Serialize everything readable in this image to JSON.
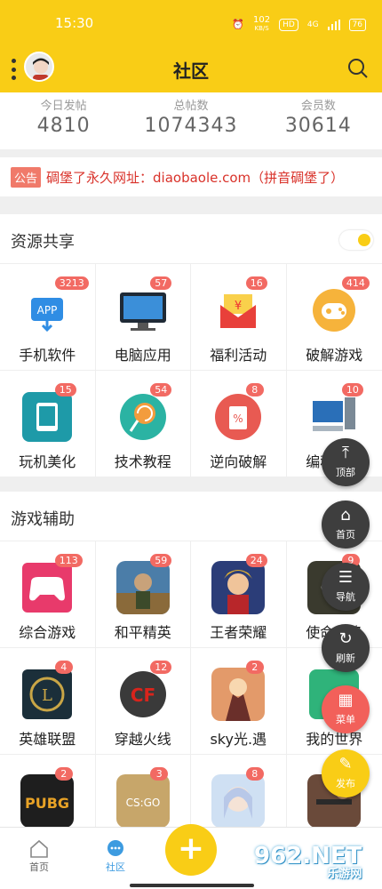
{
  "status": {
    "time": "15:30",
    "speed": "102",
    "speed_unit": "KB/S",
    "hd": "HD",
    "net": "4G",
    "battery": "76"
  },
  "header": {
    "title": "社区"
  },
  "stats": [
    {
      "label": "今日发帖",
      "value": "4810"
    },
    {
      "label": "总帖数",
      "value": "1074343"
    },
    {
      "label": "会员数",
      "value": "30614"
    }
  ],
  "notice": {
    "tag": "公告",
    "text": "碉堡了永久网址：diaobaole.com（拼音碉堡了）"
  },
  "sections": [
    {
      "title": "资源共享",
      "items": [
        {
          "label": "手机软件",
          "badge": "3213",
          "icon": "app-download-icon"
        },
        {
          "label": "电脑应用",
          "badge": "57",
          "icon": "monitor-icon"
        },
        {
          "label": "福利活动",
          "badge": "16",
          "icon": "red-envelope-icon"
        },
        {
          "label": "破解游戏",
          "badge": "414",
          "icon": "gamepad-icon"
        },
        {
          "label": "玩机美化",
          "badge": "15",
          "icon": "phone-theme-icon"
        },
        {
          "label": "技术教程",
          "badge": "54",
          "icon": "lollipop-icon"
        },
        {
          "label": "逆向破解",
          "badge": "8",
          "icon": "coupon-icon"
        },
        {
          "label": "编程源码",
          "badge": "10",
          "icon": "computer-icon"
        }
      ]
    },
    {
      "title": "游戏辅助",
      "items": [
        {
          "label": "综合游戏",
          "badge": "113",
          "icon": "controller-icon"
        },
        {
          "label": "和平精英",
          "badge": "59",
          "icon": "peace-elite-icon"
        },
        {
          "label": "王者荣耀",
          "badge": "24",
          "icon": "honor-of-kings-icon"
        },
        {
          "label": "使命召唤",
          "badge": "9",
          "icon": "call-of-duty-icon"
        },
        {
          "label": "英雄联盟",
          "badge": "4",
          "icon": "lol-icon"
        },
        {
          "label": "穿越火线",
          "badge": "12",
          "icon": "crossfire-icon"
        },
        {
          "label": "sky光.遇",
          "badge": "2",
          "icon": "sky-icon"
        },
        {
          "label": "我的世界",
          "badge": "",
          "icon": "minecraft-icon"
        },
        {
          "label": "",
          "badge": "2",
          "icon": "pubg-icon"
        },
        {
          "label": "",
          "badge": "3",
          "icon": "csgo-icon"
        },
        {
          "label": "",
          "badge": "8",
          "icon": "anime-girl-icon"
        },
        {
          "label": "",
          "badge": "",
          "icon": "shooter-game-icon"
        }
      ]
    }
  ],
  "float_menu": [
    {
      "label": "顶部",
      "icon": "to-top-icon"
    },
    {
      "label": "首页",
      "icon": "home-icon"
    },
    {
      "label": "导航",
      "icon": "list-icon"
    },
    {
      "label": "刷新",
      "icon": "refresh-icon"
    },
    {
      "label": "菜单",
      "icon": "menu-grid-icon"
    },
    {
      "label": "发布",
      "icon": "edit-icon"
    }
  ],
  "nav": [
    {
      "label": "首页"
    },
    {
      "label": "社区"
    }
  ],
  "plus_label": "+",
  "watermark": {
    "big": "962.NET",
    "small": "乐游网"
  },
  "colors": {
    "brand": "#f9cd16",
    "badge": "#f26a63",
    "notice": "#d9322a"
  }
}
